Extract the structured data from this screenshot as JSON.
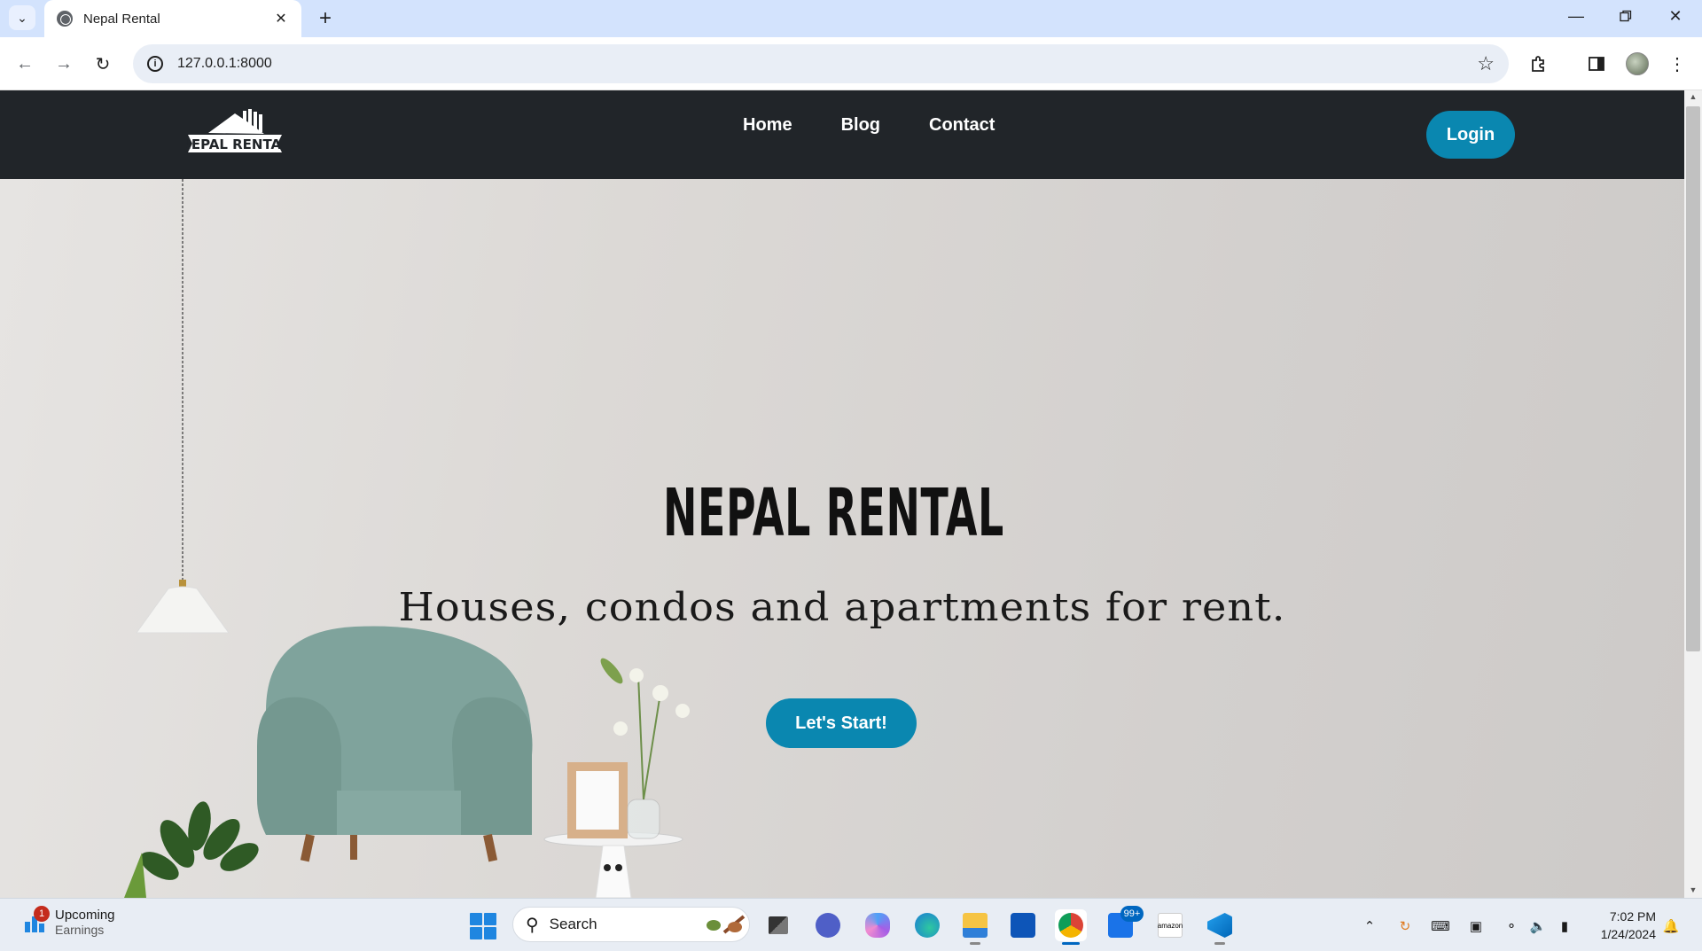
{
  "browser": {
    "tab_title": "Nepal Rental",
    "url": "127.0.0.1:8000"
  },
  "site": {
    "nav": {
      "logo_text": "NEPAL RENTAL",
      "links": [
        "Home",
        "Blog",
        "Contact"
      ],
      "login_label": "Login"
    },
    "hero": {
      "brand_name": "NEPAL RENTAL",
      "tagline": "Houses, condos and apartments for rent.",
      "cta_label": "Let's Start!"
    },
    "colors": {
      "navbar": "#212529",
      "accent": "#0a87b0",
      "armchair": "#7fa39c"
    }
  },
  "taskbar": {
    "widget_title": "Upcoming",
    "widget_subtitle": "Earnings",
    "widget_badge": "1",
    "search_placeholder": "Search",
    "mail_badge": "99+",
    "time": "7:02 PM",
    "date": "1/24/2024"
  }
}
